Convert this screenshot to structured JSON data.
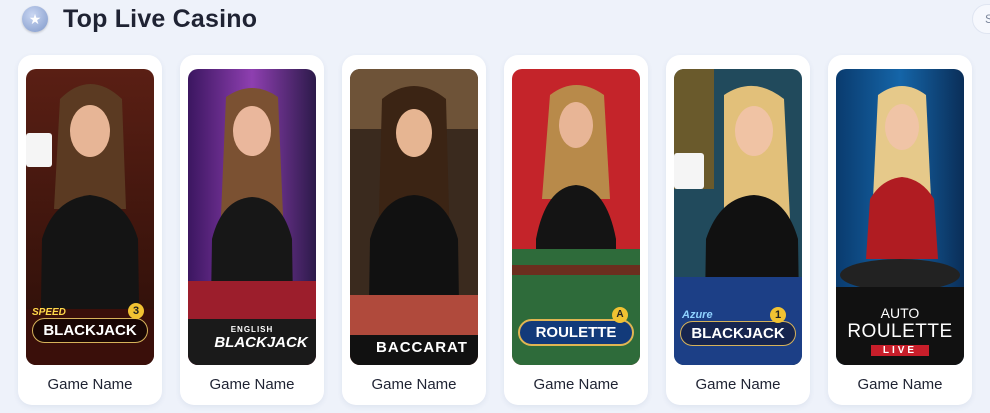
{
  "section": {
    "title": "Top Live Casino",
    "icon": "star-badge-icon",
    "see_all_label": "S"
  },
  "cards": [
    {
      "name": "Game Name",
      "logo_small": "SPEED",
      "logo_main": "BLACKJACK",
      "badge": "3"
    },
    {
      "name": "Game Name",
      "logo_small": "ENGLISH",
      "logo_main": "BLACKJACK",
      "badge": ""
    },
    {
      "name": "Game Name",
      "logo_small": "",
      "logo_main": "BACCARAT",
      "badge": ""
    },
    {
      "name": "Game Name",
      "logo_small": "",
      "logo_main": "ROULETTE",
      "badge": "A"
    },
    {
      "name": "Game Name",
      "logo_small": "Azure",
      "logo_main": "BLACKJACK",
      "badge": "1"
    },
    {
      "name": "Game Name",
      "logo_small": "AUTO",
      "logo_main": "ROULETTE",
      "badge": "LIVE"
    }
  ],
  "colors": {
    "background": "#eef2fa",
    "card": "#ffffff",
    "title": "#1f2333"
  }
}
